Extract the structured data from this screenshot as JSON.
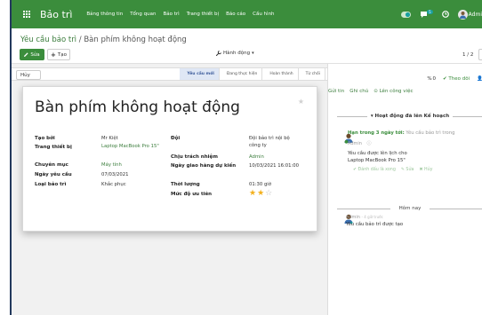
{
  "navbar": {
    "brand": "Bảo trì",
    "menu": [
      "Bảng thông tin",
      "Tổng quan",
      "Bảo trì",
      "Trang thiết bị",
      "Báo cáo",
      "Cấu hình"
    ],
    "messages_badge": "5",
    "user_name": "Admi"
  },
  "control": {
    "breadcrumb_parent": "Yêu cầu bảo trì",
    "breadcrumb_sep": " / ",
    "breadcrumb_current": "Bàn phím không hoạt động",
    "edit_label": "Sửa",
    "create_label": "Tạo",
    "action_label": "Hành động",
    "pager": "1 / 2"
  },
  "statusbar": {
    "cancel_label": "Hủy",
    "stages": [
      "Yêu cầu mới",
      "Đang thực hiện",
      "Hoàn thành",
      "Từ chối"
    ],
    "active_stage": "Yêu cầu mới"
  },
  "form": {
    "title": "Bàn phím không hoạt động",
    "created_by_label": "Tạo bởi",
    "created_by": "Mr Kiệt",
    "equipment_label": "Trang thiết bị",
    "equipment": "Laptop MacBook Pro 15\"",
    "category_label": "Chuyên mục",
    "category": "Máy tính",
    "request_date_label": "Ngày yêu cầu",
    "request_date": "07/03/2021",
    "maintenance_type_label": "Loại bảo trì",
    "maintenance_type": "Khắc phục",
    "team_label": "Đội",
    "team": "Đội bảo trì nội bộ công ty",
    "responsible_label": "Chịu trách nhiệm",
    "responsible": "Admin",
    "scheduled_date_label": "Ngày giao hàng dự kiến",
    "scheduled_date": "10/03/2021 16:01:00",
    "duration_label": "Thời lượng",
    "duration": "01:30  giờ",
    "priority_label": "Mức độ ưu tiên",
    "priority_stars": 2,
    "priority_max": 3
  },
  "chatter": {
    "attachments": "0",
    "follow_label": "Theo dõi",
    "send_message": "Gửi tin",
    "log_note": "Ghi chú",
    "schedule_activity": "Lên công việc",
    "planned_header": "Hoạt động đã lên Kế hoạch",
    "activity_due": "Hạn trong 3 ngày tới:",
    "activity_summary": "Yêu cầu bảo trì trong",
    "activity_user": "Admin",
    "activity_desc_1": "Yêu cầu được lên lịch cho",
    "activity_desc_2": "Laptop MacBook Pro 15\"",
    "act_done": "Đánh dấu là xong",
    "act_edit": "Sửa",
    "act_cancel": "Hủy",
    "today_label": "Hôm nay",
    "msg_author": "Admin",
    "msg_time": "- 4 giờ trước",
    "msg_text": "Yêu cầu bảo trì được tạo"
  },
  "colors": {
    "brand": "#3b8d3c",
    "link": "#3b7d3c",
    "star": "#f3b01c"
  }
}
